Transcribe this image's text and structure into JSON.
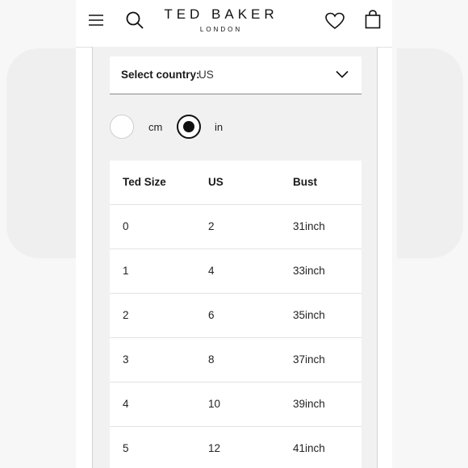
{
  "header": {
    "brand": "TED BAKER",
    "brand_sub": "LONDON"
  },
  "country_select": {
    "label": "Select country:",
    "value": "US"
  },
  "units": {
    "options": [
      {
        "label": "cm",
        "selected": false
      },
      {
        "label": "in",
        "selected": true
      }
    ]
  },
  "size_table": {
    "headers": [
      "Ted Size",
      "US",
      "Bust"
    ],
    "rows": [
      [
        "0",
        "2",
        "31inch"
      ],
      [
        "1",
        "4",
        "33inch"
      ],
      [
        "2",
        "6",
        "35inch"
      ],
      [
        "3",
        "8",
        "37inch"
      ],
      [
        "4",
        "10",
        "39inch"
      ],
      [
        "5",
        "12",
        "41inch"
      ]
    ]
  },
  "icons": [
    "menu-icon",
    "search-icon",
    "heart-icon",
    "bag-icon",
    "chevron-down-icon"
  ]
}
